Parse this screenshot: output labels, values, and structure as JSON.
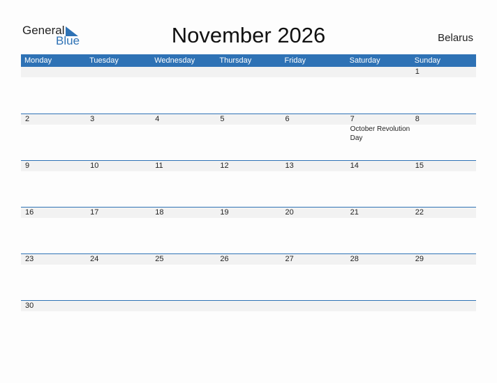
{
  "logo": {
    "general": "General",
    "blue": "Blue"
  },
  "header": {
    "title": "November 2026",
    "country": "Belarus"
  },
  "colors": {
    "accent": "#2e72b5",
    "strip": "#f2f2f2"
  },
  "weekdays": [
    "Monday",
    "Tuesday",
    "Wednesday",
    "Thursday",
    "Friday",
    "Saturday",
    "Sunday"
  ],
  "weeks": [
    {
      "days": [
        {
          "n": ""
        },
        {
          "n": ""
        },
        {
          "n": ""
        },
        {
          "n": ""
        },
        {
          "n": ""
        },
        {
          "n": ""
        },
        {
          "n": "1"
        }
      ]
    },
    {
      "days": [
        {
          "n": "2"
        },
        {
          "n": "3"
        },
        {
          "n": "4"
        },
        {
          "n": "5"
        },
        {
          "n": "6"
        },
        {
          "n": "7",
          "event": "October Revolution Day"
        },
        {
          "n": "8"
        }
      ]
    },
    {
      "days": [
        {
          "n": "9"
        },
        {
          "n": "10"
        },
        {
          "n": "11"
        },
        {
          "n": "12"
        },
        {
          "n": "13"
        },
        {
          "n": "14"
        },
        {
          "n": "15"
        }
      ]
    },
    {
      "days": [
        {
          "n": "16"
        },
        {
          "n": "17"
        },
        {
          "n": "18"
        },
        {
          "n": "19"
        },
        {
          "n": "20"
        },
        {
          "n": "21"
        },
        {
          "n": "22"
        }
      ]
    },
    {
      "days": [
        {
          "n": "23"
        },
        {
          "n": "24"
        },
        {
          "n": "25"
        },
        {
          "n": "26"
        },
        {
          "n": "27"
        },
        {
          "n": "28"
        },
        {
          "n": "29"
        }
      ]
    },
    {
      "days": [
        {
          "n": "30"
        },
        {
          "n": ""
        },
        {
          "n": ""
        },
        {
          "n": ""
        },
        {
          "n": ""
        },
        {
          "n": ""
        },
        {
          "n": ""
        }
      ]
    }
  ]
}
